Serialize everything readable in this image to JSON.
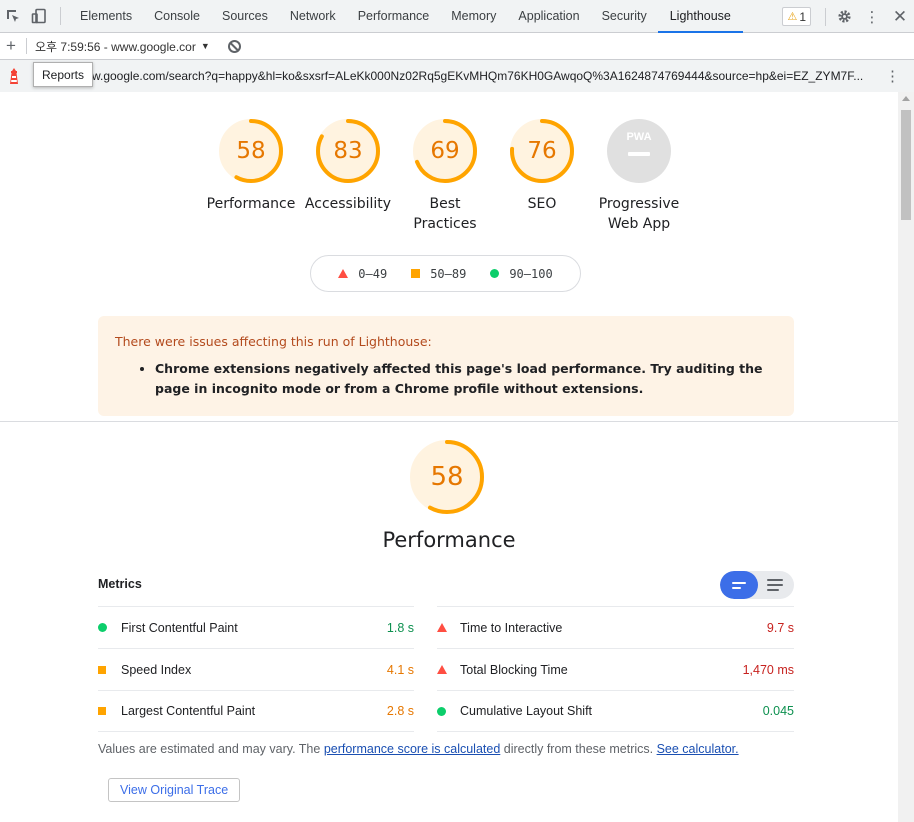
{
  "devtools": {
    "tabs": [
      "Elements",
      "Console",
      "Sources",
      "Network",
      "Performance",
      "Memory",
      "Application",
      "Security",
      "Lighthouse"
    ],
    "active_tab": "Lighthouse",
    "warning_count": "1"
  },
  "report_bar": {
    "selected_report": "오후 7:59:56 - www.google.cor"
  },
  "url_bar": {
    "url": "w.google.com/search?q=happy&hl=ko&sxsrf=ALeKk000Nz02Rq5gEKvMHQm76KH0GAwqoQ%3A1624874769444&source=hp&ei=EZ_ZYM7F...",
    "tooltip": "Reports"
  },
  "gauges": [
    {
      "label": "Performance",
      "score": "58",
      "value": 0.58
    },
    {
      "label": "Accessibility",
      "score": "83",
      "value": 0.83
    },
    {
      "label": "Best Practices",
      "score": "69",
      "value": 0.69
    },
    {
      "label": "SEO",
      "score": "76",
      "value": 0.76
    },
    {
      "label": "Progressive Web App",
      "score": "PWA",
      "value": null
    }
  ],
  "legend": [
    {
      "symbol": "triangle",
      "range": "0–49",
      "color": "#ff4e42"
    },
    {
      "symbol": "square",
      "range": "50–89",
      "color": "#ffa400"
    },
    {
      "symbol": "circle",
      "range": "90–100",
      "color": "#0cce6b"
    }
  ],
  "warning": {
    "title": "There were issues affecting this run of Lighthouse:",
    "items": [
      "Chrome extensions negatively affected this page's load performance. Try auditing the page in incognito mode or from a Chrome profile without extensions."
    ]
  },
  "performance": {
    "score": "58",
    "value": 0.58,
    "title": "Performance",
    "metrics_title": "Metrics",
    "metrics_left": [
      {
        "name": "First Contentful Paint",
        "value": "1.8 s",
        "rating": "pass"
      },
      {
        "name": "Speed Index",
        "value": "4.1 s",
        "rating": "average"
      },
      {
        "name": "Largest Contentful Paint",
        "value": "2.8 s",
        "rating": "average"
      }
    ],
    "metrics_right": [
      {
        "name": "Time to Interactive",
        "value": "9.7 s",
        "rating": "fail"
      },
      {
        "name": "Total Blocking Time",
        "value": "1,470 ms",
        "rating": "fail"
      },
      {
        "name": "Cumulative Layout Shift",
        "value": "0.045",
        "rating": "pass"
      }
    ],
    "note_prefix": "Values are estimated and may vary. The ",
    "note_link": "performance score is calculated",
    "note_middle": " directly from these metrics. ",
    "note_link2": "See calculator.",
    "trace_button": "View Original Trace"
  },
  "colors": {
    "average": "#ffa400",
    "average_text": "#e67700",
    "fail": "#ff4e42",
    "pass": "#0cce6b",
    "accent": "#1a73e8"
  }
}
